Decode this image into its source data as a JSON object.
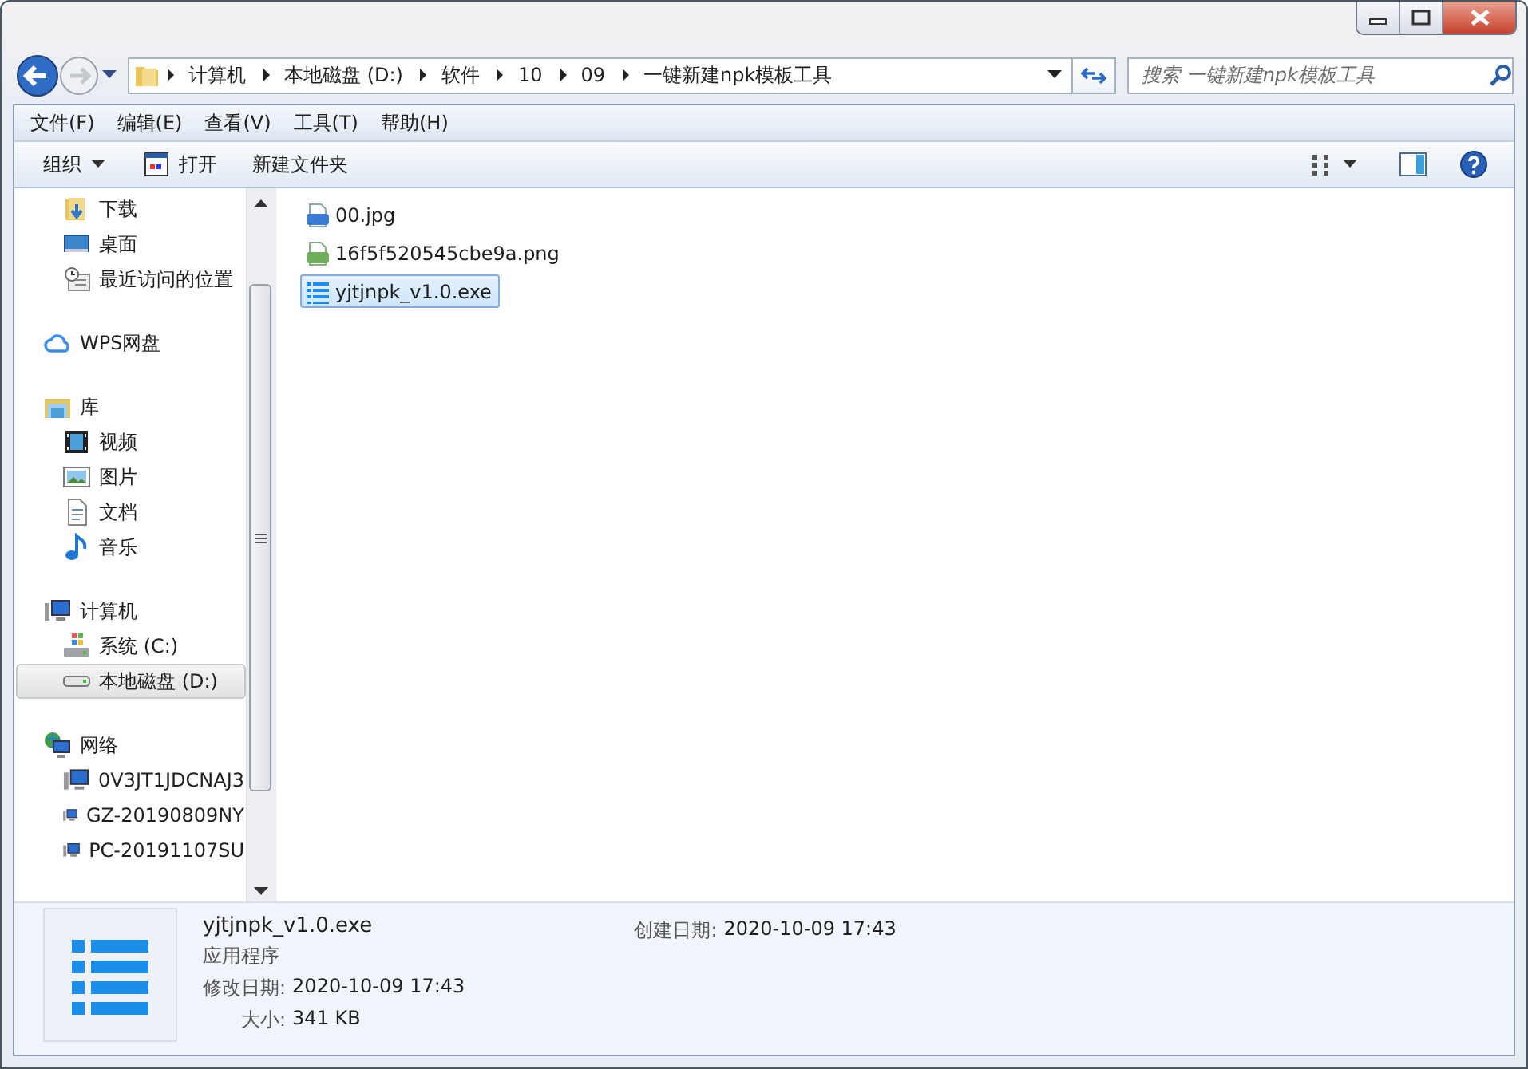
{
  "address": {
    "crumbs": [
      "计算机",
      "本地磁盘 (D:)",
      "软件",
      "10",
      "09",
      "一键新建npk模板工具"
    ]
  },
  "search": {
    "placeholder": "搜索 一键新建npk模板工具"
  },
  "menu": [
    {
      "label": "文件(F)"
    },
    {
      "label": "编辑(E)"
    },
    {
      "label": "查看(V)"
    },
    {
      "label": "工具(T)"
    },
    {
      "label": "帮助(H)"
    }
  ],
  "toolbar": {
    "organize": "组织",
    "open": "打开",
    "new_folder": "新建文件夹"
  },
  "nav": {
    "favorites": [
      {
        "label": "下载",
        "kind": "download",
        "selected": false
      },
      {
        "label": "桌面",
        "kind": "desktop",
        "selected": false
      },
      {
        "label": "最近访问的位置",
        "kind": "recent",
        "selected": false
      }
    ],
    "tree": [
      {
        "label": "WPS网盘",
        "kind": "cloud",
        "selected": false
      },
      {
        "label": "库",
        "kind": "library",
        "selected": false,
        "children": [
          {
            "label": "视频",
            "kind": "video",
            "selected": false
          },
          {
            "label": "图片",
            "kind": "picture",
            "selected": false
          },
          {
            "label": "文档",
            "kind": "document",
            "selected": false
          },
          {
            "label": "音乐",
            "kind": "music",
            "selected": false
          }
        ]
      },
      {
        "label": "计算机",
        "kind": "computer",
        "selected": false,
        "children": [
          {
            "label": "系统 (C:)",
            "kind": "sysdrive",
            "selected": false
          },
          {
            "label": "本地磁盘 (D:)",
            "kind": "drive",
            "selected": true
          }
        ]
      },
      {
        "label": "网络",
        "kind": "network",
        "selected": false,
        "children": [
          {
            "label": "0V3JT1JDCNAJ3",
            "kind": "computer",
            "selected": false
          },
          {
            "label": "GZ-20190809NY",
            "kind": "computer",
            "selected": false
          },
          {
            "label": "PC-20191107SU",
            "kind": "computer",
            "selected": false
          }
        ]
      }
    ]
  },
  "files": [
    {
      "name": "00.jpg",
      "kind": "jpg",
      "selected": false
    },
    {
      "name": "16f5f520545cbe9a.png",
      "kind": "png",
      "selected": false
    },
    {
      "name": "yjtjnpk_v1.0.exe",
      "kind": "exe",
      "selected": true
    }
  ],
  "details": {
    "name": "yjtjnpk_v1.0.exe",
    "type": "应用程序",
    "fields": [
      {
        "label": "修改日期:",
        "value": "2020-10-09 17:43"
      },
      {
        "label": "大小:",
        "value": "341 KB"
      }
    ],
    "created": {
      "label": "创建日期:",
      "value": "2020-10-09 17:43"
    }
  }
}
